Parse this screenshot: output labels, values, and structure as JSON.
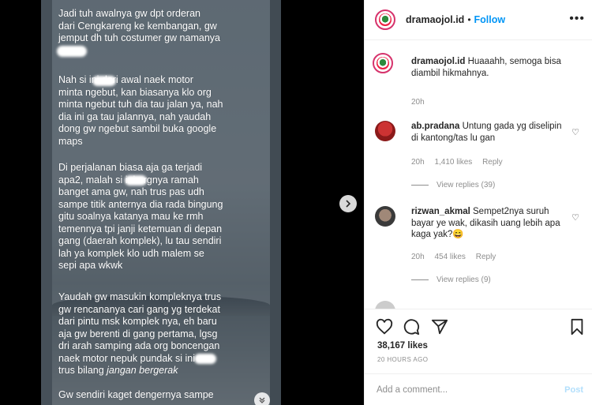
{
  "post_text": {
    "m1": "Jadi tuh awalnya gw dpt orderan\ndari Cengkareng ke kembangan, gw\njemput dh tuh costumer gw namanya",
    "m2": "Nah si        ini dari awal naek motor\nminta ngebut, kan biasanya klo org\nminta ngebut tuh dia tau jalan ya, nah\ndia ini ga tau jalannya, nah yaudah\ndong gw ngebut sambil buka google\nmaps",
    "m3": "Di perjalanan biasa aja ga terjadi\napa2, malah si        ini orgnya ramah\nbanget ama gw, nah trus pas udh\nsampe titik anternya dia rada bingung\ngitu soalnya katanya mau ke rmh\ntemennya tpi janji ketemuan di depan\ngang (daerah komplek), lu tau sendiri\nlah ya komplek klo udh malem se\nsepi apa wkwk",
    "m4_main": "Yaudah gw masukin kompleknya trus\ngw rencananya cari gang yg terdekat\ndari pintu msk komplek nya, eh baru\naja gw berenti di gang pertama, lgsg\ndri arah samping ada org boncengan\nnaek motor nepuk pundak si         ini\ntrus bilang ",
    "m4_italic": "jangan bergerak",
    "m5": "Gw sendiri kaget dengernya sampe"
  },
  "header": {
    "username": "dramaojol.id",
    "separator": "•",
    "follow_label": "Follow",
    "more_label": "•••"
  },
  "comments": [
    {
      "username": "dramaojol.id",
      "text": "Huaaahh, semoga bisa diambil hikmahnya.",
      "time": "20h"
    },
    {
      "username": "ab.pradana",
      "text": "Untung gada yg diselipin di kantong/tas lu gan",
      "time": "20h",
      "likes": "1,410 likes",
      "reply": "Reply",
      "views": "View replies (39)"
    },
    {
      "username": "rizwan_akmal",
      "text": "Sempet2nya suruh bayar ye wak, dikasih uang lebih apa kaga yak?😄",
      "time": "20h",
      "likes": "454 likes",
      "reply": "Reply",
      "views": "View replies (9)"
    }
  ],
  "actions": {
    "likes": "38,167 likes",
    "time_ago": "20 HOURS AGO"
  },
  "add_comment": {
    "placeholder": "Add a comment...",
    "post_label": "Post"
  },
  "icons": {
    "like": "heart-icon",
    "comment": "comment-icon",
    "share": "paper-plane-icon",
    "save": "bookmark-icon",
    "next": "chevron-right-icon"
  },
  "colors": {
    "follow": "#0095f6",
    "post_disabled": "#b2dffc",
    "avatar_ring": "#d6336c"
  }
}
